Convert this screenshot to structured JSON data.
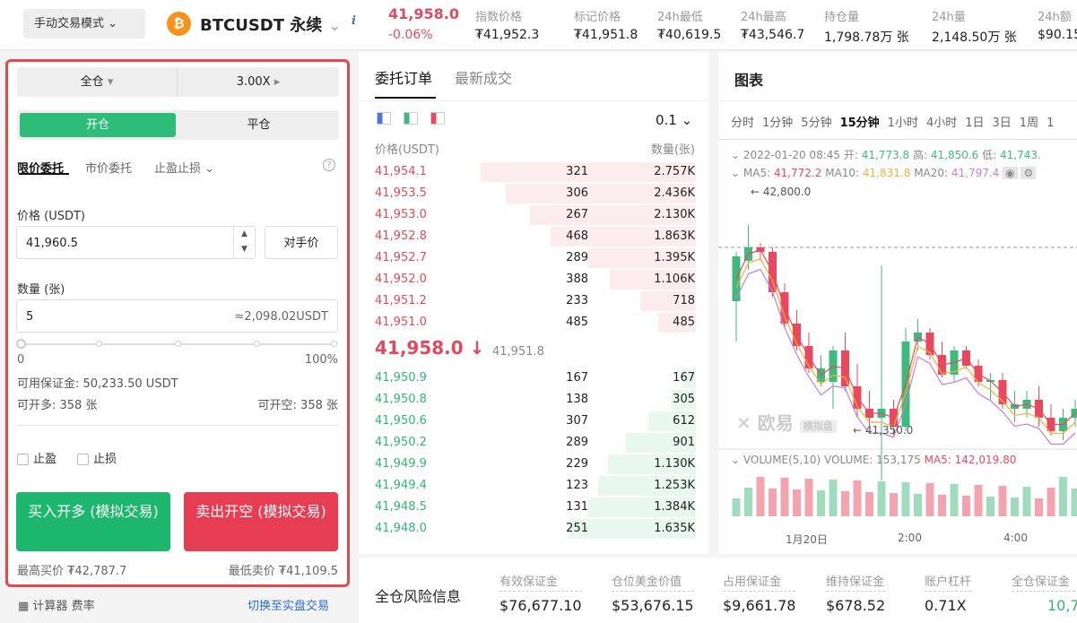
{
  "header": {
    "mode": "手动交易模式",
    "symbol": "BTCUSDT 永续",
    "last_price": "41,958.0",
    "change": "-0.06%",
    "stats": [
      {
        "label": "指数价格",
        "value": "₮41,952.3"
      },
      {
        "label": "标记价格",
        "value": "₮41,951.8"
      },
      {
        "label": "24h最低",
        "value": "₮40,619.5"
      },
      {
        "label": "24h最高",
        "value": "₮43,546.7"
      },
      {
        "label": "持仓量",
        "value": "1,798.78万 张"
      },
      {
        "label": "24h量",
        "value": "2,148.50万 张"
      },
      {
        "label": "24h额",
        "value": "$90.15"
      }
    ]
  },
  "order": {
    "margin_mode": "全仓",
    "leverage": "3.00X",
    "open": "开仓",
    "close": "平仓",
    "tabs": [
      "限价委托",
      "市价委托",
      "止盈止损"
    ],
    "price_label": "价格 (USDT)",
    "price": "41,960.5",
    "counter_price": "对手价",
    "qty_label": "数量 (张)",
    "qty": "5",
    "qty_approx": "≈2,098.02USDT",
    "slider_min": "0",
    "slider_max": "100%",
    "slider_value": 0,
    "available": "可用保证金: 50,233.50 USDT",
    "can_long": "可开多: 358 张",
    "can_short": "可开空: 358 张",
    "take_profit": "止盈",
    "stop_loss": "止损",
    "buy": "买入开多 (模拟交易)",
    "sell": "卖出开空 (模拟交易)",
    "max_buy": "最高买价 ₮42,787.7",
    "min_sell": "最低卖价 ₮41,109.5",
    "calc": "计算器",
    "fee": "费率",
    "switch": "切换至实盘交易"
  },
  "book": {
    "tabs": [
      "委托订单",
      "最新成交"
    ],
    "precision": "0.1",
    "col_price": "价格(USDT)",
    "col_qty": "数量(张)",
    "asks": [
      [
        "41,954.1",
        "321",
        "2.757K"
      ],
      [
        "41,953.5",
        "306",
        "2.436K"
      ],
      [
        "41,953.0",
        "267",
        "2.130K"
      ],
      [
        "41,952.8",
        "468",
        "1.863K"
      ],
      [
        "41,952.7",
        "289",
        "1.395K"
      ],
      [
        "41,952.0",
        "388",
        "1.106K"
      ],
      [
        "41,951.2",
        "233",
        "718"
      ],
      [
        "41,951.0",
        "485",
        "485"
      ]
    ],
    "mid": "41,958.0 ↓",
    "mark": "41,951.8",
    "bids": [
      [
        "41,950.9",
        "167",
        "167"
      ],
      [
        "41,950.8",
        "138",
        "305"
      ],
      [
        "41,950.6",
        "307",
        "612"
      ],
      [
        "41,950.2",
        "289",
        "901"
      ],
      [
        "41,949.9",
        "229",
        "1.130K"
      ],
      [
        "41,949.4",
        "123",
        "1.253K"
      ],
      [
        "41,948.5",
        "131",
        "1.384K"
      ],
      [
        "41,948.0",
        "251",
        "1.635K"
      ]
    ]
  },
  "chart": {
    "title": "图表",
    "intervals": [
      "分时",
      "1分钟",
      "5分钟",
      "15分钟",
      "1小时",
      "4小时",
      "1日",
      "3日",
      "1周",
      "1"
    ],
    "active": "15分钟",
    "ohlc_line": "2022-01-20 08:45",
    "open_l": "开:",
    "open": "41,773.8",
    "high_l": "高:",
    "high": "41,850.6",
    "low_l": "低:",
    "low": "41,743.",
    "ma5_l": "MA5:",
    "ma5": "41,772.2",
    "ma10_l": "MA10:",
    "ma10": "41,831.8",
    "ma20_l": "MA20:",
    "ma20": "41,797.4",
    "max_label": "← 42,800.0",
    "min_label": "← 41,350.0",
    "watermark": "欧易",
    "sim": "模拟盘",
    "vol_l": "VOLUME(5,10)",
    "vol": "VOLUME: 153,175",
    "vma5": "MA5: 142,019.80",
    "times": [
      "1月20日",
      "2:00",
      "4:00"
    ],
    "colors": {
      "up": "#3dba7c",
      "down": "#e9495e",
      "ma5": "#e9495e",
      "ma10": "#f2b134",
      "ma20": "#c77ddb"
    }
  },
  "risk": {
    "title": "全仓风险信息",
    "items": [
      {
        "label": "有效保证金",
        "value": "$76,677.10"
      },
      {
        "label": "仓位美金价值",
        "value": "$53,676.15"
      },
      {
        "label": "占用保证金",
        "value": "$9,661.78"
      },
      {
        "label": "维持保证金",
        "value": "$678.52"
      },
      {
        "label": "账户杠杆",
        "value": "0.71X"
      },
      {
        "label": "全仓保证金",
        "value": "10,7"
      }
    ]
  }
}
